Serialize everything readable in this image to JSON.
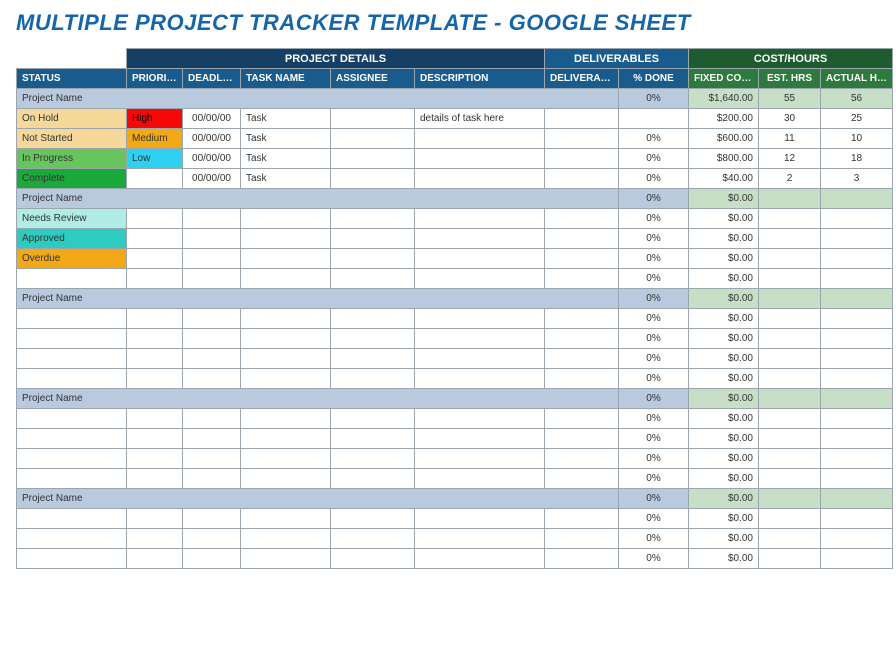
{
  "title": "MULTIPLE PROJECT TRACKER TEMPLATE - GOOGLE SHEET",
  "groupHeaders": {
    "projectDetails": "PROJECT DETAILS",
    "deliverables": "DELIVERABLES",
    "costHours": "COST/HOURS"
  },
  "columns": {
    "status": "STATUS",
    "priority": "PRIORITY",
    "deadline": "DEADLINE",
    "taskName": "TASK NAME",
    "assignee": "ASSIGNEE",
    "description": "DESCRIPTION",
    "deliverable": "DELIVERABLE",
    "pctDone": "% DONE",
    "fixedCost": "FIXED COST",
    "estHrs": "EST. HRS",
    "actualHrs": "ACTUAL HRS"
  },
  "projects": [
    {
      "name": "Project Name",
      "pctDone": "0%",
      "fixedCost": "$1,640.00",
      "estHrs": "55",
      "actualHrs": "56",
      "rows": [
        {
          "status": "On Hold",
          "statusClass": "st-onhold",
          "priority": "High",
          "priorityClass": "pr-high",
          "deadline": "00/00/00",
          "taskName": "Task",
          "assignee": "",
          "description": "details of task here",
          "deliverable": "",
          "pctDone": "",
          "fixedCost": "$200.00",
          "estHrs": "30",
          "actualHrs": "25"
        },
        {
          "status": "Not Started",
          "statusClass": "st-notstarted",
          "priority": "Medium",
          "priorityClass": "pr-medium",
          "deadline": "00/00/00",
          "taskName": "Task",
          "assignee": "",
          "description": "",
          "deliverable": "",
          "pctDone": "0%",
          "fixedCost": "$600.00",
          "estHrs": "11",
          "actualHrs": "10"
        },
        {
          "status": "In Progress",
          "statusClass": "st-inprogress",
          "priority": "Low",
          "priorityClass": "pr-low",
          "deadline": "00/00/00",
          "taskName": "Task",
          "assignee": "",
          "description": "",
          "deliverable": "",
          "pctDone": "0%",
          "fixedCost": "$800.00",
          "estHrs": "12",
          "actualHrs": "18"
        },
        {
          "status": "Complete",
          "statusClass": "st-complete",
          "priority": "",
          "priorityClass": "",
          "deadline": "00/00/00",
          "taskName": "Task",
          "assignee": "",
          "description": "",
          "deliverable": "",
          "pctDone": "0%",
          "fixedCost": "$40.00",
          "estHrs": "2",
          "actualHrs": "3"
        }
      ]
    },
    {
      "name": "Project Name",
      "pctDone": "0%",
      "fixedCost": "$0.00",
      "estHrs": "",
      "actualHrs": "",
      "rows": [
        {
          "status": "Needs Review",
          "statusClass": "st-needsreview",
          "priority": "",
          "priorityClass": "",
          "deadline": "",
          "taskName": "",
          "assignee": "",
          "description": "",
          "deliverable": "",
          "pctDone": "0%",
          "fixedCost": "$0.00",
          "estHrs": "",
          "actualHrs": ""
        },
        {
          "status": "Approved",
          "statusClass": "st-approved",
          "priority": "",
          "priorityClass": "",
          "deadline": "",
          "taskName": "",
          "assignee": "",
          "description": "",
          "deliverable": "",
          "pctDone": "0%",
          "fixedCost": "$0.00",
          "estHrs": "",
          "actualHrs": ""
        },
        {
          "status": "Overdue",
          "statusClass": "st-overdue",
          "priority": "",
          "priorityClass": "",
          "deadline": "",
          "taskName": "",
          "assignee": "",
          "description": "",
          "deliverable": "",
          "pctDone": "0%",
          "fixedCost": "$0.00",
          "estHrs": "",
          "actualHrs": ""
        },
        {
          "status": "",
          "statusClass": "",
          "priority": "",
          "priorityClass": "",
          "deadline": "",
          "taskName": "",
          "assignee": "",
          "description": "",
          "deliverable": "",
          "pctDone": "0%",
          "fixedCost": "$0.00",
          "estHrs": "",
          "actualHrs": ""
        }
      ]
    },
    {
      "name": "Project Name",
      "pctDone": "0%",
      "fixedCost": "$0.00",
      "estHrs": "",
      "actualHrs": "",
      "rows": [
        {
          "status": "",
          "statusClass": "",
          "priority": "",
          "priorityClass": "",
          "deadline": "",
          "taskName": "",
          "assignee": "",
          "description": "",
          "deliverable": "",
          "pctDone": "0%",
          "fixedCost": "$0.00",
          "estHrs": "",
          "actualHrs": ""
        },
        {
          "status": "",
          "statusClass": "",
          "priority": "",
          "priorityClass": "",
          "deadline": "",
          "taskName": "",
          "assignee": "",
          "description": "",
          "deliverable": "",
          "pctDone": "0%",
          "fixedCost": "$0.00",
          "estHrs": "",
          "actualHrs": ""
        },
        {
          "status": "",
          "statusClass": "",
          "priority": "",
          "priorityClass": "",
          "deadline": "",
          "taskName": "",
          "assignee": "",
          "description": "",
          "deliverable": "",
          "pctDone": "0%",
          "fixedCost": "$0.00",
          "estHrs": "",
          "actualHrs": ""
        },
        {
          "status": "",
          "statusClass": "",
          "priority": "",
          "priorityClass": "",
          "deadline": "",
          "taskName": "",
          "assignee": "",
          "description": "",
          "deliverable": "",
          "pctDone": "0%",
          "fixedCost": "$0.00",
          "estHrs": "",
          "actualHrs": ""
        }
      ]
    },
    {
      "name": "Project Name",
      "pctDone": "0%",
      "fixedCost": "$0.00",
      "estHrs": "",
      "actualHrs": "",
      "rows": [
        {
          "status": "",
          "statusClass": "",
          "priority": "",
          "priorityClass": "",
          "deadline": "",
          "taskName": "",
          "assignee": "",
          "description": "",
          "deliverable": "",
          "pctDone": "0%",
          "fixedCost": "$0.00",
          "estHrs": "",
          "actualHrs": ""
        },
        {
          "status": "",
          "statusClass": "",
          "priority": "",
          "priorityClass": "",
          "deadline": "",
          "taskName": "",
          "assignee": "",
          "description": "",
          "deliverable": "",
          "pctDone": "0%",
          "fixedCost": "$0.00",
          "estHrs": "",
          "actualHrs": ""
        },
        {
          "status": "",
          "statusClass": "",
          "priority": "",
          "priorityClass": "",
          "deadline": "",
          "taskName": "",
          "assignee": "",
          "description": "",
          "deliverable": "",
          "pctDone": "0%",
          "fixedCost": "$0.00",
          "estHrs": "",
          "actualHrs": ""
        },
        {
          "status": "",
          "statusClass": "",
          "priority": "",
          "priorityClass": "",
          "deadline": "",
          "taskName": "",
          "assignee": "",
          "description": "",
          "deliverable": "",
          "pctDone": "0%",
          "fixedCost": "$0.00",
          "estHrs": "",
          "actualHrs": ""
        }
      ]
    },
    {
      "name": "Project Name",
      "pctDone": "0%",
      "fixedCost": "$0.00",
      "estHrs": "",
      "actualHrs": "",
      "rows": [
        {
          "status": "",
          "statusClass": "",
          "priority": "",
          "priorityClass": "",
          "deadline": "",
          "taskName": "",
          "assignee": "",
          "description": "",
          "deliverable": "",
          "pctDone": "0%",
          "fixedCost": "$0.00",
          "estHrs": "",
          "actualHrs": ""
        },
        {
          "status": "",
          "statusClass": "",
          "priority": "",
          "priorityClass": "",
          "deadline": "",
          "taskName": "",
          "assignee": "",
          "description": "",
          "deliverable": "",
          "pctDone": "0%",
          "fixedCost": "$0.00",
          "estHrs": "",
          "actualHrs": ""
        },
        {
          "status": "",
          "statusClass": "",
          "priority": "",
          "priorityClass": "",
          "deadline": "",
          "taskName": "",
          "assignee": "",
          "description": "",
          "deliverable": "",
          "pctDone": "0%",
          "fixedCost": "$0.00",
          "estHrs": "",
          "actualHrs": ""
        }
      ]
    }
  ]
}
